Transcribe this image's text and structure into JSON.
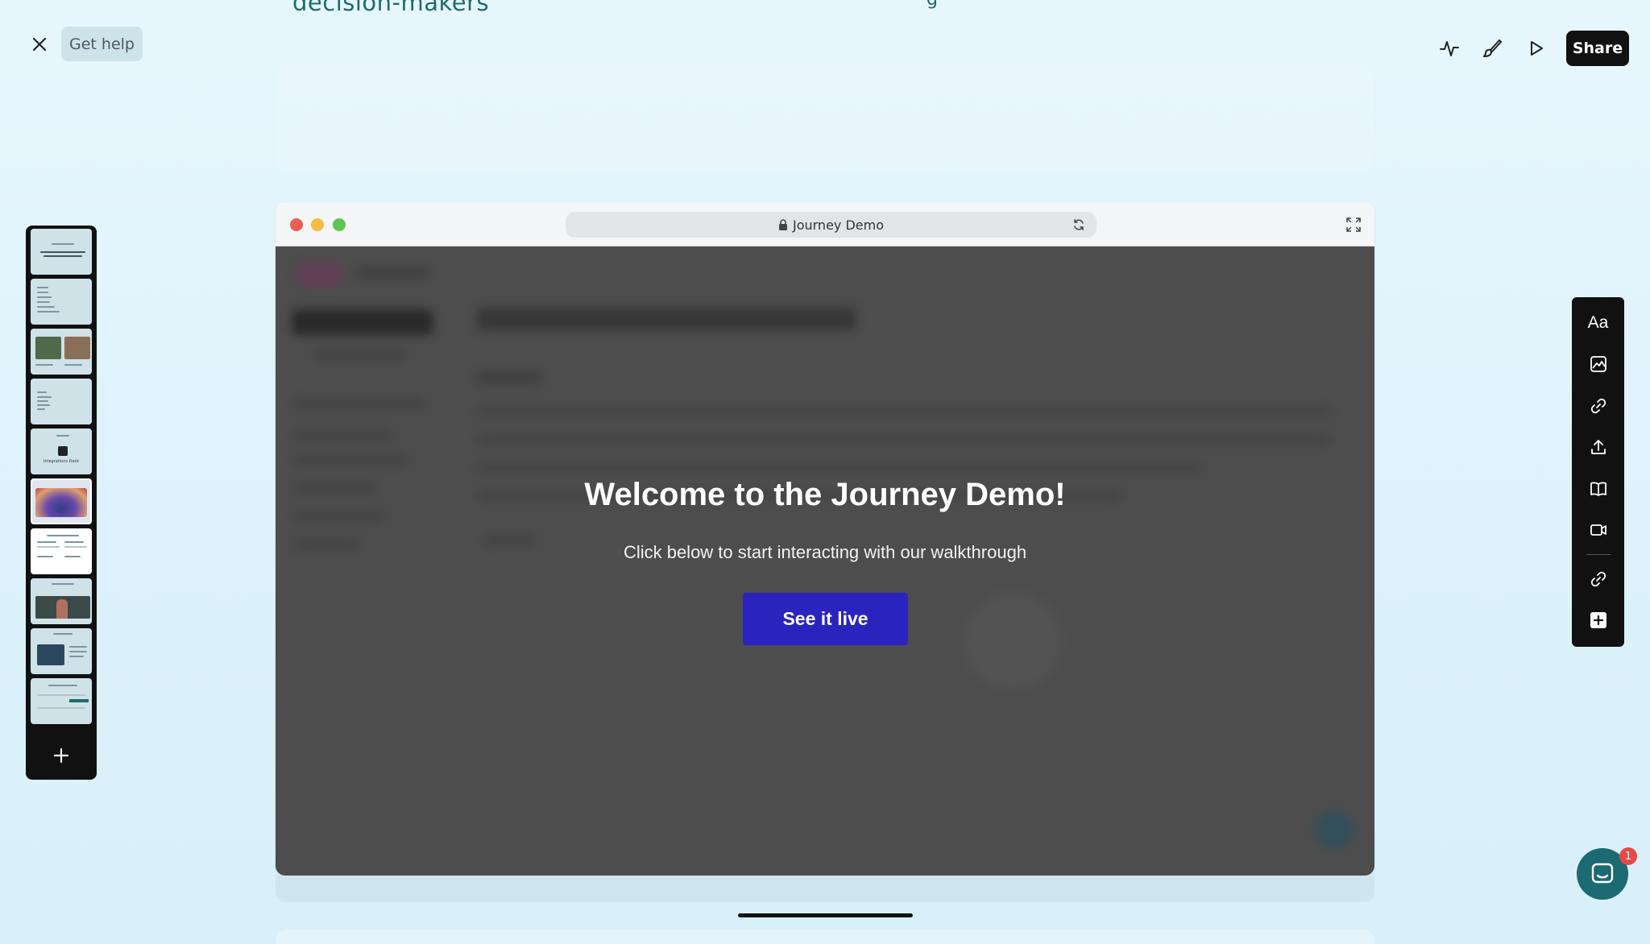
{
  "page": {
    "heading_fragment": "decision-makers"
  },
  "topbar": {
    "get_help_label": "Get help",
    "share_label": "Share",
    "icons": [
      "close-icon",
      "pulse-icon",
      "brush-icon",
      "play-icon"
    ]
  },
  "slides_rail": {
    "slide_count": 10,
    "active_index": 5,
    "thumb_texts": [
      "",
      "",
      "",
      "",
      "Integrations Dock",
      "",
      "",
      "",
      "",
      ""
    ]
  },
  "browser": {
    "url_title": "Journey Demo",
    "icons": [
      "lock-icon",
      "reload-icon",
      "expand-icon"
    ]
  },
  "demo": {
    "title": "Welcome to the Journey Demo!",
    "subtitle": "Click below to start interacting with our walkthrough",
    "cta_label": "See it live",
    "cta_color": "#2b23bd"
  },
  "right_toolbar": {
    "text_label": "Aa",
    "icons": [
      "text-icon",
      "image-icon",
      "link-icon",
      "upload-icon",
      "book-icon",
      "video-icon",
      "link-icon",
      "add-icon"
    ]
  },
  "chat": {
    "badge_count": "1"
  },
  "colors": {
    "background": "#e6f6fd",
    "accent_teal": "#1d6b6b",
    "cta_blue": "#2b23bd",
    "badge_red": "#e84848"
  }
}
